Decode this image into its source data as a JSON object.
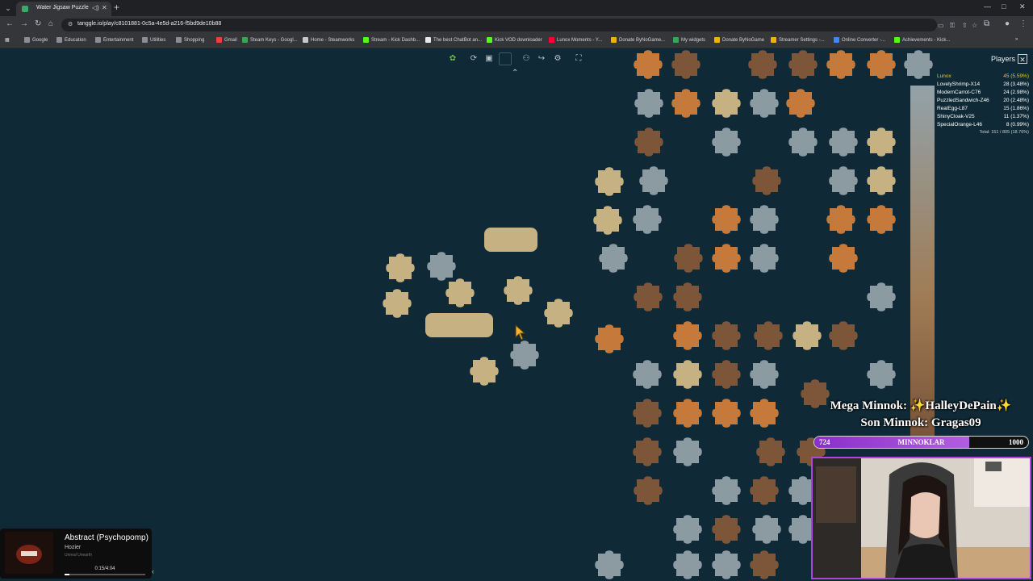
{
  "browser": {
    "tab_title": "Water Jigsaw Puzzle",
    "url": "tanggle.io/play/c8101881-0c5a-4e5d-a216-f5bd9de10b88",
    "bookmarks": [
      {
        "label": "Google",
        "color": "#8a8d91"
      },
      {
        "label": "Education",
        "color": "#8a8d91"
      },
      {
        "label": "Entertainment",
        "color": "#8a8d91"
      },
      {
        "label": "Utilities",
        "color": "#8a8d91"
      },
      {
        "label": "Shopping",
        "color": "#8a8d91"
      },
      {
        "label": "Gmail",
        "color": "#ea4335"
      },
      {
        "label": "Steam Keys - Googl...",
        "color": "#34a853"
      },
      {
        "label": "Home - Steamworks",
        "color": "#c8c8c8"
      },
      {
        "label": "Stream - Kick Dashb...",
        "color": "#53fc18"
      },
      {
        "label": "The best ChatBot an...",
        "color": "#e8e8e8"
      },
      {
        "label": "Kick VOD downloader",
        "color": "#53fc18"
      },
      {
        "label": "Lunox Moments - Y...",
        "color": "#ff0033"
      },
      {
        "label": "Donate ByNoGame...",
        "color": "#f0b400"
      },
      {
        "label": "My widgets",
        "color": "#34a853"
      },
      {
        "label": "Donate ByNoGame",
        "color": "#f0b400"
      },
      {
        "label": "Streamer Settings -...",
        "color": "#f0b400"
      },
      {
        "label": "Online Converter -...",
        "color": "#4285f4"
      },
      {
        "label": "Achievements - Kick...",
        "color": "#53fc18"
      }
    ]
  },
  "players": {
    "title": "Players",
    "list": [
      {
        "name": "Lunox",
        "score": "45 (5.59%)",
        "color": "#f0c419"
      },
      {
        "name": "LovelyShrimp-X14",
        "score": "28 (3.48%)",
        "color": "#ffffff"
      },
      {
        "name": "ModernCarrot-C76",
        "score": "24 (2.98%)",
        "color": "#ffffff"
      },
      {
        "name": "PuzzledSandwich-Z46",
        "score": "20 (2.48%)",
        "color": "#ffffff"
      },
      {
        "name": "RealEgg-L87",
        "score": "15 (1.86%)",
        "color": "#ffffff"
      },
      {
        "name": "ShinyCloak-V25",
        "score": "11 (1.37%)",
        "color": "#ffffff"
      },
      {
        "name": "SpecialOrange-L46",
        "score": "8 (0.99%)",
        "color": "#ffffff"
      }
    ],
    "total": "Total: 151 / 805 (18.76%)"
  },
  "overlay": {
    "mega": "Mega Minnok: ✨HalleyDePain✨",
    "son": "Son Minnok: Gragas09",
    "goal_current": "724",
    "goal_label": "MINNOKLAR",
    "goal_target": "1000",
    "goal_progress": 0.724
  },
  "music": {
    "title": "Abstract (Psychopomp)",
    "artist": "Hozier",
    "subtitle": "Unreal Unearth",
    "time": "0:15/4:04",
    "progress": 0.06
  },
  "colors": {
    "background": "#0f2a36",
    "piece_gold": "#d9c08a",
    "piece_orange": "#d9823c",
    "piece_gray": "#9aa7ad",
    "piece_brown": "#8a5a3a",
    "accent_purple": "#b045d8"
  }
}
